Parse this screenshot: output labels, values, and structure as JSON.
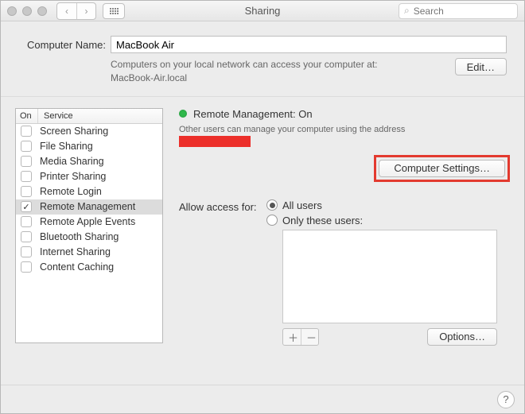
{
  "title": "Sharing",
  "search_placeholder": "Search",
  "computer_name_label": "Computer Name:",
  "computer_name_value": "MacBook Air",
  "hostname_hint_line1": "Computers on your local network can access your computer at:",
  "hostname_hint_line2": "MacBook-Air.local",
  "edit_label": "Edit…",
  "columns": {
    "on": "On",
    "service": "Service"
  },
  "services": [
    {
      "label": "Screen Sharing",
      "on": false
    },
    {
      "label": "File Sharing",
      "on": false
    },
    {
      "label": "Media Sharing",
      "on": false
    },
    {
      "label": "Printer Sharing",
      "on": false
    },
    {
      "label": "Remote Login",
      "on": false
    },
    {
      "label": "Remote Management",
      "on": true
    },
    {
      "label": "Remote Apple Events",
      "on": false
    },
    {
      "label": "Bluetooth Sharing",
      "on": false
    },
    {
      "label": "Internet Sharing",
      "on": false
    },
    {
      "label": "Content Caching",
      "on": false
    }
  ],
  "status_title": "Remote Management: On",
  "status_sub": "Other users can manage your computer using the address",
  "computer_settings_label": "Computer Settings…",
  "allow_label": "Allow access for:",
  "radio_all": "All users",
  "radio_these": "Only these users:",
  "options_label": "Options…",
  "help_label": "?"
}
